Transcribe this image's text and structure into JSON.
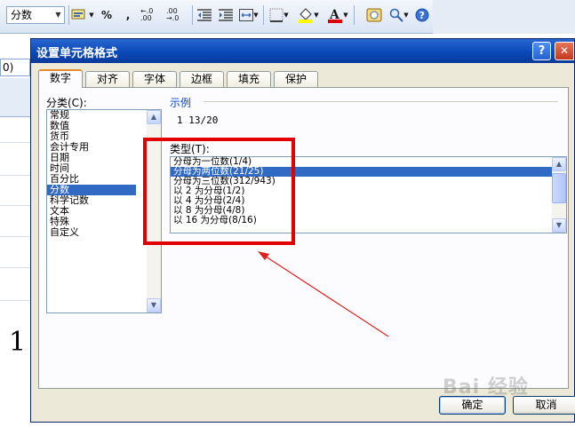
{
  "toolbar": {
    "number_format": "分数",
    "percent": "%",
    "comma": ",",
    "increase_decimal": "←.0 .00",
    "decrease_decimal": ".00 →.0"
  },
  "sheet": {
    "namebox_value": "0)",
    "cell_value": "1"
  },
  "dialog": {
    "title": "设置单元格格式",
    "help": "?",
    "close": "✕",
    "tabs": [
      "数字",
      "对齐",
      "字体",
      "边框",
      "填充",
      "保护"
    ],
    "active_tab": "数字",
    "category_label": "分类(C):",
    "categories": [
      "常规",
      "数值",
      "货币",
      "会计专用",
      "日期",
      "时间",
      "百分比",
      "分数",
      "科学记数",
      "文本",
      "特殊",
      "自定义"
    ],
    "selected_category": "分数",
    "sample_label": "示例",
    "sample_value": "1 13/20",
    "type_label": "类型(T):",
    "types": [
      "分母为一位数(1/4)",
      "分母为两位数(21/25)",
      "分母为三位数(312/943)",
      "以 2 为分母(1/2)",
      "以 4 为分母(2/4)",
      "以 8 为分母(4/8)",
      "以 16 为分母(8/16)"
    ],
    "selected_type": "分母为两位数(21/25)",
    "ok": "确定",
    "cancel": "取消"
  },
  "watermark": "Bai 经验",
  "colors": {
    "highlight": "#e00000",
    "selection": "#316ac5",
    "titlebar": "#0a49b8"
  },
  "icons": [
    "format-painter-icon",
    "indent-decrease-icon",
    "indent-increase-icon",
    "borders-icon",
    "fill-color-icon",
    "font-color-icon",
    "research-icon",
    "zoom-icon",
    "help-icon"
  ]
}
